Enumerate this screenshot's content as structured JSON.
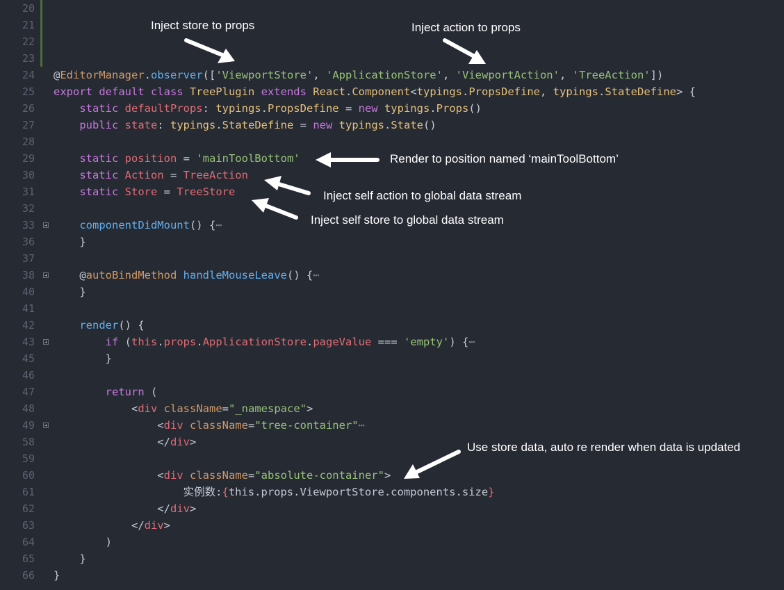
{
  "colors": {
    "background": "#262a33",
    "line_number": "#5c6370",
    "keyword": "#c678dd",
    "string": "#98c379",
    "function": "#61afef",
    "class": "#e5c07b",
    "property": "#e06c75",
    "annotation": "#ffffff"
  },
  "lines": [
    {
      "num": "20",
      "fold": false,
      "tokens": []
    },
    {
      "num": "21",
      "fold": false,
      "tokens": []
    },
    {
      "num": "22",
      "fold": false,
      "tokens": []
    },
    {
      "num": "23",
      "fold": false,
      "tokens": []
    },
    {
      "num": "24",
      "fold": false,
      "tokens": [
        {
          "t": "@",
          "c": "def"
        },
        {
          "t": "EditorManager",
          "c": "dec"
        },
        {
          "t": ".",
          "c": "def"
        },
        {
          "t": "observer",
          "c": "fn"
        },
        {
          "t": "([",
          "c": "def"
        },
        {
          "t": "'ViewportStore'",
          "c": "str"
        },
        {
          "t": ", ",
          "c": "def"
        },
        {
          "t": "'ApplicationStore'",
          "c": "str"
        },
        {
          "t": ", ",
          "c": "def"
        },
        {
          "t": "'ViewportAction'",
          "c": "str"
        },
        {
          "t": ", ",
          "c": "def"
        },
        {
          "t": "'TreeAction'",
          "c": "str"
        },
        {
          "t": "])",
          "c": "def"
        }
      ]
    },
    {
      "num": "25",
      "fold": false,
      "tokens": [
        {
          "t": "export default class ",
          "c": "kw"
        },
        {
          "t": "TreePlugin",
          "c": "cls"
        },
        {
          "t": " extends ",
          "c": "kw"
        },
        {
          "t": "React",
          "c": "cls"
        },
        {
          "t": ".",
          "c": "def"
        },
        {
          "t": "Component",
          "c": "cls"
        },
        {
          "t": "<",
          "c": "def"
        },
        {
          "t": "typings",
          "c": "cls"
        },
        {
          "t": ".",
          "c": "def"
        },
        {
          "t": "PropsDefine",
          "c": "cls"
        },
        {
          "t": ", ",
          "c": "def"
        },
        {
          "t": "typings",
          "c": "cls"
        },
        {
          "t": ".",
          "c": "def"
        },
        {
          "t": "StateDefine",
          "c": "cls"
        },
        {
          "t": "> {",
          "c": "def"
        }
      ]
    },
    {
      "num": "26",
      "fold": false,
      "tokens": [
        {
          "t": "    static ",
          "c": "kw"
        },
        {
          "t": "defaultProps",
          "c": "prop"
        },
        {
          "t": ": ",
          "c": "def"
        },
        {
          "t": "typings",
          "c": "cls"
        },
        {
          "t": ".",
          "c": "def"
        },
        {
          "t": "PropsDefine",
          "c": "cls"
        },
        {
          "t": " = ",
          "c": "def"
        },
        {
          "t": "new ",
          "c": "kw"
        },
        {
          "t": "typings",
          "c": "cls"
        },
        {
          "t": ".",
          "c": "def"
        },
        {
          "t": "Props",
          "c": "cls"
        },
        {
          "t": "()",
          "c": "def"
        }
      ]
    },
    {
      "num": "27",
      "fold": false,
      "tokens": [
        {
          "t": "    public ",
          "c": "kw"
        },
        {
          "t": "state",
          "c": "prop"
        },
        {
          "t": ": ",
          "c": "def"
        },
        {
          "t": "typings",
          "c": "cls"
        },
        {
          "t": ".",
          "c": "def"
        },
        {
          "t": "StateDefine",
          "c": "cls"
        },
        {
          "t": " = ",
          "c": "def"
        },
        {
          "t": "new ",
          "c": "kw"
        },
        {
          "t": "typings",
          "c": "cls"
        },
        {
          "t": ".",
          "c": "def"
        },
        {
          "t": "State",
          "c": "cls"
        },
        {
          "t": "()",
          "c": "def"
        }
      ]
    },
    {
      "num": "28",
      "fold": false,
      "tokens": []
    },
    {
      "num": "29",
      "fold": false,
      "tokens": [
        {
          "t": "    static ",
          "c": "kw"
        },
        {
          "t": "position",
          "c": "prop"
        },
        {
          "t": " = ",
          "c": "def"
        },
        {
          "t": "'mainToolBottom'",
          "c": "str"
        }
      ]
    },
    {
      "num": "30",
      "fold": false,
      "tokens": [
        {
          "t": "    static ",
          "c": "kw"
        },
        {
          "t": "Action",
          "c": "prop"
        },
        {
          "t": " = ",
          "c": "def"
        },
        {
          "t": "TreeAction",
          "c": "prop"
        }
      ]
    },
    {
      "num": "31",
      "fold": false,
      "tokens": [
        {
          "t": "    static ",
          "c": "kw"
        },
        {
          "t": "Store",
          "c": "prop"
        },
        {
          "t": " = ",
          "c": "def"
        },
        {
          "t": "TreeStore",
          "c": "prop"
        }
      ]
    },
    {
      "num": "32",
      "fold": false,
      "tokens": []
    },
    {
      "num": "33",
      "fold": true,
      "tokens": [
        {
          "t": "    ",
          "c": "def"
        },
        {
          "t": "componentDidMount",
          "c": "fn"
        },
        {
          "t": "() {",
          "c": "def"
        },
        {
          "t": "⋯",
          "c": "mute"
        }
      ]
    },
    {
      "num": "36",
      "fold": false,
      "tokens": [
        {
          "t": "    }",
          "c": "def"
        }
      ]
    },
    {
      "num": "37",
      "fold": false,
      "tokens": []
    },
    {
      "num": "38",
      "fold": true,
      "tokens": [
        {
          "t": "    @",
          "c": "def"
        },
        {
          "t": "autoBindMethod",
          "c": "dec"
        },
        {
          "t": " ",
          "c": "def"
        },
        {
          "t": "handleMouseLeave",
          "c": "fn"
        },
        {
          "t": "() {",
          "c": "def"
        },
        {
          "t": "⋯",
          "c": "mute"
        }
      ]
    },
    {
      "num": "40",
      "fold": false,
      "tokens": [
        {
          "t": "    }",
          "c": "def"
        }
      ]
    },
    {
      "num": "41",
      "fold": false,
      "tokens": []
    },
    {
      "num": "42",
      "fold": false,
      "tokens": [
        {
          "t": "    ",
          "c": "def"
        },
        {
          "t": "render",
          "c": "fn"
        },
        {
          "t": "() {",
          "c": "def"
        }
      ]
    },
    {
      "num": "43",
      "fold": true,
      "tokens": [
        {
          "t": "        if ",
          "c": "kw"
        },
        {
          "t": "(",
          "c": "def"
        },
        {
          "t": "this",
          "c": "prop"
        },
        {
          "t": ".",
          "c": "def"
        },
        {
          "t": "props",
          "c": "prop"
        },
        {
          "t": ".",
          "c": "def"
        },
        {
          "t": "ApplicationStore",
          "c": "prop"
        },
        {
          "t": ".",
          "c": "def"
        },
        {
          "t": "pageValue",
          "c": "prop"
        },
        {
          "t": " === ",
          "c": "def"
        },
        {
          "t": "'empty'",
          "c": "str"
        },
        {
          "t": ") {",
          "c": "def"
        },
        {
          "t": "⋯",
          "c": "mute"
        }
      ]
    },
    {
      "num": "45",
      "fold": false,
      "tokens": [
        {
          "t": "        }",
          "c": "def"
        }
      ]
    },
    {
      "num": "46",
      "fold": false,
      "tokens": []
    },
    {
      "num": "47",
      "fold": false,
      "tokens": [
        {
          "t": "        return ",
          "c": "kw"
        },
        {
          "t": "(",
          "c": "def"
        }
      ]
    },
    {
      "num": "48",
      "fold": false,
      "tokens": [
        {
          "t": "            <",
          "c": "def"
        },
        {
          "t": "div",
          "c": "tag"
        },
        {
          "t": " ",
          "c": "def"
        },
        {
          "t": "className",
          "c": "attr"
        },
        {
          "t": "=",
          "c": "def"
        },
        {
          "t": "\"_namespace\"",
          "c": "str"
        },
        {
          "t": ">",
          "c": "def"
        }
      ]
    },
    {
      "num": "49",
      "fold": true,
      "tokens": [
        {
          "t": "                <",
          "c": "def"
        },
        {
          "t": "div",
          "c": "tag"
        },
        {
          "t": " ",
          "c": "def"
        },
        {
          "t": "className",
          "c": "attr"
        },
        {
          "t": "=",
          "c": "def"
        },
        {
          "t": "\"tree-container\"",
          "c": "str"
        },
        {
          "t": "⋯",
          "c": "mute"
        }
      ]
    },
    {
      "num": "58",
      "fold": false,
      "tokens": [
        {
          "t": "                </",
          "c": "def"
        },
        {
          "t": "div",
          "c": "tag"
        },
        {
          "t": ">",
          "c": "def"
        }
      ]
    },
    {
      "num": "59",
      "fold": false,
      "tokens": []
    },
    {
      "num": "60",
      "fold": false,
      "tokens": [
        {
          "t": "                <",
          "c": "def"
        },
        {
          "t": "div",
          "c": "tag"
        },
        {
          "t": " ",
          "c": "def"
        },
        {
          "t": "className",
          "c": "attr"
        },
        {
          "t": "=",
          "c": "def"
        },
        {
          "t": "\"absolute-container\"",
          "c": "str"
        },
        {
          "t": ">",
          "c": "def"
        }
      ]
    },
    {
      "num": "61",
      "fold": false,
      "tokens": [
        {
          "t": "                    实例数:",
          "c": "def"
        },
        {
          "t": "{",
          "c": "prop"
        },
        {
          "t": "this",
          "c": "def"
        },
        {
          "t": ".",
          "c": "def"
        },
        {
          "t": "props",
          "c": "def"
        },
        {
          "t": ".",
          "c": "def"
        },
        {
          "t": "ViewportStore",
          "c": "def"
        },
        {
          "t": ".",
          "c": "def"
        },
        {
          "t": "components",
          "c": "def"
        },
        {
          "t": ".",
          "c": "def"
        },
        {
          "t": "size",
          "c": "def"
        },
        {
          "t": "}",
          "c": "prop"
        }
      ]
    },
    {
      "num": "62",
      "fold": false,
      "tokens": [
        {
          "t": "                </",
          "c": "def"
        },
        {
          "t": "div",
          "c": "tag"
        },
        {
          "t": ">",
          "c": "def"
        }
      ]
    },
    {
      "num": "63",
      "fold": false,
      "tokens": [
        {
          "t": "            </",
          "c": "def"
        },
        {
          "t": "div",
          "c": "tag"
        },
        {
          "t": ">",
          "c": "def"
        }
      ]
    },
    {
      "num": "64",
      "fold": false,
      "tokens": [
        {
          "t": "        )",
          "c": "def"
        }
      ]
    },
    {
      "num": "65",
      "fold": false,
      "tokens": [
        {
          "t": "    }",
          "c": "def"
        }
      ]
    },
    {
      "num": "66",
      "fold": false,
      "tokens": [
        {
          "t": "}",
          "c": "def"
        }
      ]
    }
  ],
  "annotations": {
    "store": "Inject store to props",
    "action": "Inject action to props",
    "position": "Render to position named ‘mainToolBottom’",
    "self_action": "Inject self action to global data stream",
    "self_store": "Inject self store to global data stream",
    "store_data": "Use store data,  auto re render when data is updated"
  }
}
